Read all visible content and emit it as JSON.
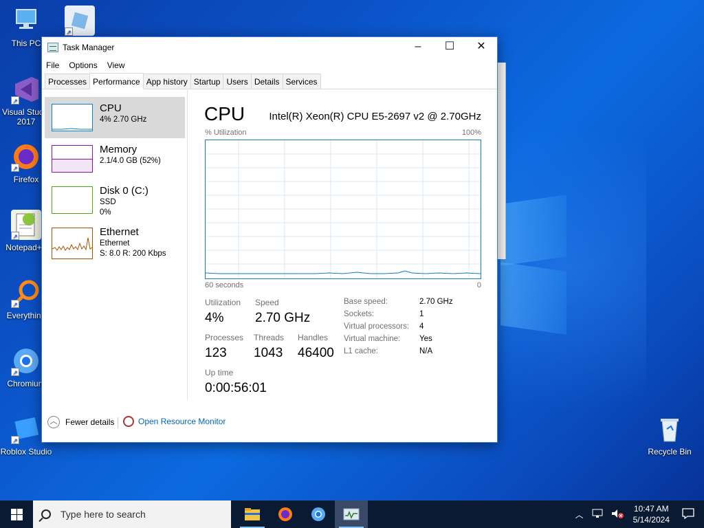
{
  "desktop": {
    "icons": [
      {
        "label": "This PC"
      },
      {
        "label": "Visual Studio 2017"
      },
      {
        "label": "Firefox"
      },
      {
        "label": "Notepad++"
      },
      {
        "label": "Everything"
      },
      {
        "label": "Chromium"
      },
      {
        "label": "Roblox Studio"
      },
      {
        "label": "Recycle Bin"
      }
    ]
  },
  "window": {
    "title": "Task Manager",
    "menu": [
      "File",
      "Options",
      "View"
    ],
    "tabs": [
      "Processes",
      "Performance",
      "App history",
      "Startup",
      "Users",
      "Details",
      "Services"
    ],
    "active_tab": "Performance"
  },
  "resources": [
    {
      "name": "CPU",
      "line1": "4%  2.70 GHz",
      "line2": ""
    },
    {
      "name": "Memory",
      "line1": "2.1/4.0 GB (52%)",
      "line2": ""
    },
    {
      "name": "Disk 0 (C:)",
      "line1": "SSD",
      "line2": "0%"
    },
    {
      "name": "Ethernet",
      "line1": "Ethernet",
      "line2": "S: 8.0  R: 200 Kbps"
    }
  ],
  "cpu": {
    "title": "CPU",
    "model": "Intel(R) Xeon(R) CPU E5-2697 v2 @ 2.70GHz",
    "graph_label": "% Utilization",
    "graph_max": "100%",
    "graph_left": "60 seconds",
    "graph_right": "0",
    "stats": {
      "utilization_label": "Utilization",
      "utilization": "4%",
      "speed_label": "Speed",
      "speed": "2.70 GHz",
      "processes_label": "Processes",
      "processes": "123",
      "threads_label": "Threads",
      "threads": "1043",
      "handles_label": "Handles",
      "handles": "46400",
      "uptime_label": "Up time",
      "uptime": "0:00:56:01"
    },
    "details": [
      {
        "key": "Base speed:",
        "value": "2.70 GHz"
      },
      {
        "key": "Sockets:",
        "value": "1"
      },
      {
        "key": "Virtual processors:",
        "value": "4"
      },
      {
        "key": "Virtual machine:",
        "value": "Yes"
      },
      {
        "key": "L1 cache:",
        "value": "N/A"
      }
    ]
  },
  "footer": {
    "fewer_details": "Fewer details",
    "open_resource_monitor": "Open Resource Monitor"
  },
  "taskbar": {
    "search_placeholder": "Type here to search",
    "time": "10:47 AM",
    "date": "5/14/2024"
  },
  "colors": {
    "cpu_graph": "#117dbb",
    "memory_graph": "#8b12ae",
    "disk_graph": "#4da60c",
    "ethernet_graph": "#a74f01"
  }
}
